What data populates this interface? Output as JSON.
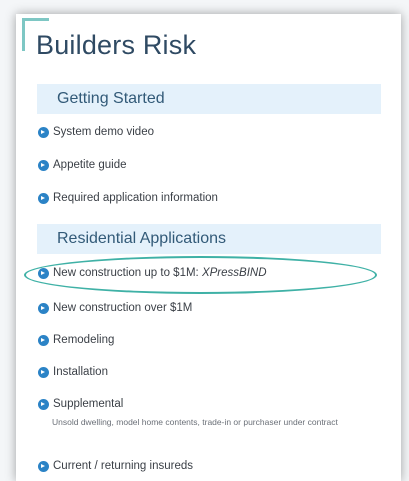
{
  "page": {
    "title": "Builders Risk"
  },
  "sections": [
    {
      "header": "Getting Started",
      "items": [
        {
          "label": "System demo video"
        },
        {
          "label": "Appetite guide"
        },
        {
          "label": "Required application information"
        }
      ]
    },
    {
      "header": "Residential Applications",
      "items": [
        {
          "label": "New construction up to $1M:",
          "label_italic": "XPressBIND"
        },
        {
          "label": "New construction over $1M"
        },
        {
          "label": "Remodeling"
        },
        {
          "label": "Installation"
        },
        {
          "label": "Supplemental",
          "description": "Unsold dwelling, model home contents, trade-in or purchaser under contract"
        },
        {
          "label": "Current / returning insureds"
        }
      ]
    }
  ],
  "icons": {
    "bullet": "play-circle-icon"
  },
  "colors": {
    "title": "#2f4a63",
    "header_bg": "#e4f1fb",
    "bullet": "#2b83c6",
    "highlight": "#3fb1a6"
  }
}
